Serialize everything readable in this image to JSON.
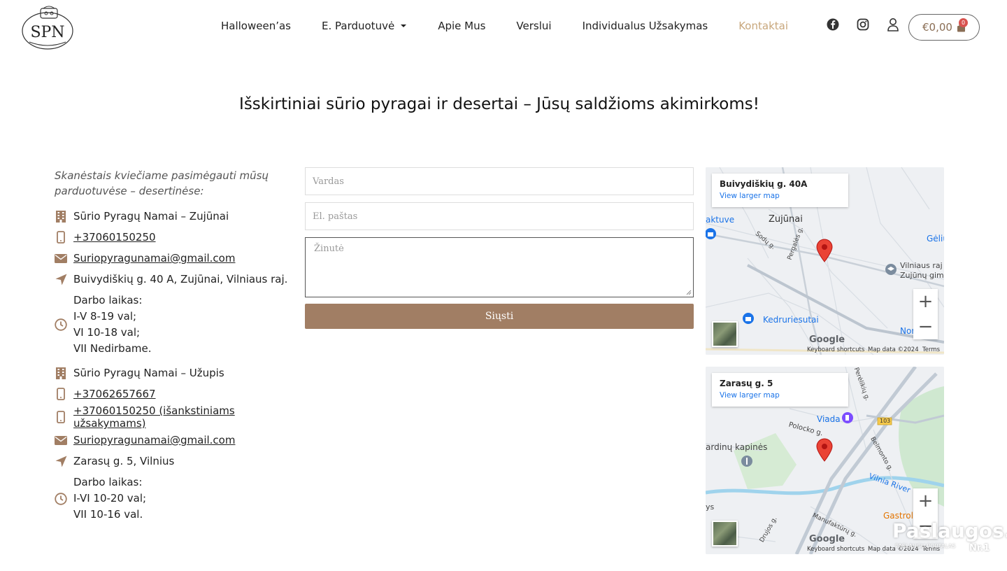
{
  "header": {
    "logo_text": "SPN",
    "nav": [
      {
        "label": "Halloween’as"
      },
      {
        "label": "E. Parduotuvė"
      },
      {
        "label": "Apie Mus"
      },
      {
        "label": "Verslui"
      },
      {
        "label": "Individualus Užsakymas"
      },
      {
        "label": "Kontaktai"
      }
    ],
    "active_color": "#c8a77c",
    "icons": [
      "facebook-icon",
      "instagram-icon",
      "user-icon"
    ],
    "cart": {
      "amount": "€0,00",
      "count": "0"
    }
  },
  "heading": "Išskirtiniai sūrio pyragai ir desertai – Jūsų saldžioms akimirkoms!",
  "info": {
    "intro": "Skanėstais kviečiame pasimėgauti mūsų parduotuvėse – desertinėse:",
    "shop1": {
      "name": "Sūrio Pyragų Namai – Zujūnai",
      "phone": "+37060150250",
      "email": "Suriopyragunamai@gmail.com",
      "address": "Buivydiškių g. 40 A, Zujūnai, Vilniaus raj.",
      "hours_title": "Darbo laikas:",
      "hours": [
        "I-V 8-19 val;",
        "VI 10-18 val;",
        "VII Nedirbame."
      ]
    },
    "shop2": {
      "name": "Sūrio Pyragų Namai – Užupis",
      "phone": "+37062657667",
      "phone2": "+37060150250 (išankstiniams užsakymams)",
      "email": "Suriopyragunamai@gmail.com",
      "address": "Zarasų g. 5, Vilnius",
      "hours_title": "Darbo laikas:",
      "hours": [
        "I-VI 10-20 val;",
        "VII 10-16 val."
      ]
    },
    "icon_color": "#a17e64"
  },
  "form": {
    "name_placeholder": "Vardas",
    "email_placeholder": "El. paštas",
    "message_placeholder": "Žinutė",
    "submit_label": "Siųsti",
    "submit_color": "#a17e64"
  },
  "maps": [
    {
      "title": "Buivydiškių g. 40A",
      "link": "View larger map",
      "labels": {
        "town": "Zujūnai",
        "store": "aktuve",
        "gel": "Gėliu",
        "school1": "Vilniaus raj",
        "school2": "Zujūnų gim",
        "kedr": "Kedruriesutai",
        "norfa": "Norfa",
        "sody": "Sodų g.",
        "perg": "Pergalės g."
      },
      "footer": {
        "google": "Google",
        "keyboard": "Keyboard shortcuts",
        "mapdata": "Map data ©2024",
        "terms": "Terms"
      }
    },
    {
      "title": "Zarasų g. 5",
      "link": "View larger map",
      "labels": {
        "viada": "Viada",
        "road": "103",
        "kapines": "ardinų kapinės",
        "polocko": "Polocko g.",
        "river": "Vilnia River",
        "gastro": "Gastrole",
        "belm": "Belmonto g.",
        "manuf": "Manufaktūrų g.",
        "drujos": "Drujos g.",
        "perel": "Perėlikių g.",
        "ys": "ys"
      },
      "footer": {
        "google": "Google",
        "keyboard": "Keyboard shortcuts",
        "mapdata": "Map data ©2024",
        "terms": "Terms"
      }
    }
  ],
  "watermark": {
    "brand": "Paslaugos.lt",
    "sub": "PASLAUGŲ PORTALAS",
    "nr": "Nr.1"
  }
}
